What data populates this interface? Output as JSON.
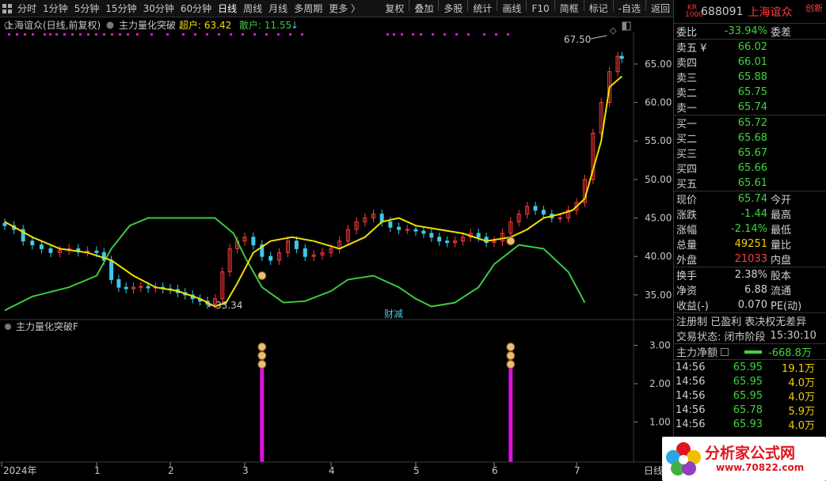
{
  "toolbar": {
    "left_items": [
      "分时",
      "1分钟",
      "5分钟",
      "15分钟",
      "30分钟",
      "60分钟",
      "日线",
      "周线",
      "月线",
      "多周期",
      "更多 〉"
    ],
    "active_item": "日线",
    "right_items": [
      "复权",
      "叠加",
      "多股",
      "统计",
      "画线",
      "F10",
      "简框",
      "标记",
      "-自选",
      "返回"
    ]
  },
  "main_chart": {
    "stock_label": "上海谊众(日线,前复权)",
    "indicator_name": "主力量化突破",
    "chao_label": "超户: 63.42",
    "san_label": "散户: 11.55",
    "high_label": "67.50",
    "low_label": "33.34",
    "annotation": "财减",
    "y_ticks": [
      "65.00",
      "60.00",
      "55.00",
      "50.00",
      "45.00",
      "40.00",
      "35.00"
    ]
  },
  "sub_chart": {
    "indicator_name": "主力量化突破F",
    "y_ticks": [
      "3.00",
      "2.00",
      "1.00"
    ],
    "signal_months": [
      "3",
      "6"
    ]
  },
  "x_axis": {
    "labels": [
      "2024年",
      "1",
      "2",
      "3",
      "4",
      "5",
      "6",
      "7"
    ],
    "period_label": "日线"
  },
  "chart_data": {
    "type": "line",
    "series": [
      {
        "name": "超户",
        "color": "#3ec83e",
        "x_month": [
          0.0,
          0.3,
          0.7,
          1.0,
          1.2,
          1.45,
          1.7,
          2.0,
          2.3,
          2.6,
          2.85,
          3.0,
          3.2,
          3.45,
          3.7,
          4.0,
          4.2,
          4.5,
          4.8,
          5.0,
          5.2,
          5.5,
          5.8,
          6.0,
          6.3,
          6.6,
          6.9,
          7.1
        ],
        "values": [
          33.0,
          34.8,
          36.0,
          37.5,
          41.0,
          44.0,
          45.0,
          45.0,
          45.0,
          45.0,
          43.0,
          40.0,
          36.0,
          34.0,
          34.2,
          35.5,
          37.0,
          37.5,
          36.0,
          34.5,
          33.5,
          34.0,
          36.0,
          39.0,
          41.5,
          41.0,
          38.0,
          34.0
        ]
      },
      {
        "name": "散户",
        "color": "#f0e000",
        "x_month": [
          0.0,
          0.3,
          0.6,
          0.9,
          1.2,
          1.5,
          1.8,
          2.1,
          2.4,
          2.6,
          2.75,
          2.9,
          3.1,
          3.3,
          3.55,
          3.8,
          4.1,
          4.4,
          4.6,
          4.8,
          5.0,
          5.3,
          5.6,
          5.9,
          6.2,
          6.4,
          6.6,
          6.8,
          6.95,
          7.1,
          7.3,
          7.4,
          7.55
        ],
        "values": [
          44.5,
          42.5,
          41.0,
          40.5,
          39.5,
          37.5,
          36.0,
          35.5,
          34.5,
          33.5,
          34.0,
          36.5,
          40.5,
          42.0,
          42.5,
          42.0,
          41.0,
          42.5,
          44.5,
          45.0,
          44.0,
          43.5,
          43.0,
          42.0,
          42.5,
          43.5,
          45.0,
          45.5,
          46.0,
          47.5,
          55.0,
          62.0,
          63.4
        ]
      }
    ],
    "candles_x_month": [
      0.0,
      0.1,
      0.2,
      0.3,
      0.4,
      0.5,
      0.6,
      0.7,
      0.8,
      0.9,
      1.0,
      1.1,
      1.2,
      1.3,
      1.4,
      1.5,
      1.6,
      1.7,
      1.8,
      1.9,
      2.0,
      2.1,
      2.2,
      2.3,
      2.4,
      2.5,
      2.6,
      2.7,
      2.8,
      2.9,
      3.0,
      3.1,
      3.2,
      3.3,
      3.4,
      3.5,
      3.6,
      3.7,
      3.8,
      3.9,
      4.0,
      4.1,
      4.2,
      4.3,
      4.4,
      4.5,
      4.6,
      4.7,
      4.8,
      4.9,
      5.0,
      5.1,
      5.2,
      5.3,
      5.4,
      5.5,
      5.6,
      5.7,
      5.8,
      5.9,
      6.0,
      6.1,
      6.2,
      6.3,
      6.4,
      6.5,
      6.6,
      6.7,
      6.8,
      6.9,
      7.0,
      7.1,
      7.2,
      7.3,
      7.4,
      7.5,
      7.55
    ],
    "candles_close": [
      44.0,
      43.5,
      42.0,
      41.5,
      41.0,
      40.5,
      40.8,
      41.0,
      40.6,
      40.7,
      40.5,
      39.5,
      37.0,
      36.0,
      35.8,
      36.0,
      36.1,
      35.9,
      36.0,
      35.8,
      35.7,
      35.3,
      35.0,
      34.5,
      34.2,
      33.8,
      34.5,
      38.0,
      41.0,
      42.0,
      42.5,
      41.5,
      40.0,
      39.5,
      40.5,
      42.0,
      41.0,
      40.0,
      40.2,
      40.5,
      41.0,
      42.0,
      43.5,
      44.5,
      45.0,
      45.5,
      44.5,
      43.8,
      43.5,
      43.5,
      43.3,
      43.0,
      42.5,
      42.0,
      41.8,
      42.0,
      42.5,
      43.0,
      42.5,
      41.8,
      42.0,
      43.0,
      44.5,
      45.5,
      46.5,
      46.0,
      45.5,
      45.0,
      45.0,
      46.0,
      47.0,
      50.0,
      56.0,
      60.0,
      64.0,
      66.0,
      65.74
    ],
    "x_range_month": [
      0,
      7.8
    ],
    "y_range": [
      32,
      69
    ],
    "signal_x_month": [
      3.2,
      6.2
    ],
    "signal_value": 3.0,
    "sub_y_range": [
      0,
      3.3
    ],
    "colors": {
      "up": "#ff3b3b",
      "down": "#3fc9e8",
      "grid": "#2a2a2a",
      "signal": "#e010e0"
    }
  },
  "panel": {
    "kr_top": "KR",
    "kr_bottom": "1000",
    "code": "688091",
    "name": "上海谊众",
    "badge": "创新",
    "weibi": {
      "label": "委比",
      "value": "-33.94%",
      "extra": "委差"
    },
    "sells": [
      {
        "label": "卖五 ¥",
        "price": "66.02"
      },
      {
        "label": "卖四",
        "price": "66.01"
      },
      {
        "label": "卖三",
        "price": "65.88"
      },
      {
        "label": "卖二",
        "price": "65.75"
      },
      {
        "label": "卖一",
        "price": "65.74"
      }
    ],
    "buys": [
      {
        "label": "买一",
        "price": "65.72"
      },
      {
        "label": "买二",
        "price": "65.68"
      },
      {
        "label": "买三",
        "price": "65.67"
      },
      {
        "label": "买四",
        "price": "65.66"
      },
      {
        "label": "买五",
        "price": "65.61"
      }
    ],
    "quote": [
      {
        "k": "现价",
        "v": "65.74",
        "cls": "green",
        "k2": "今开"
      },
      {
        "k": "涨跌",
        "v": "-1.44",
        "cls": "green",
        "k2": "最高"
      },
      {
        "k": "涨幅",
        "v": "-2.14%",
        "cls": "green",
        "k2": "最低"
      },
      {
        "k": "总量",
        "v": "49251",
        "cls": "yellow",
        "k2": "量比"
      },
      {
        "k": "外盘",
        "v": "21033",
        "cls": "red",
        "k2": "内盘"
      }
    ],
    "stats": [
      {
        "k": "换手",
        "v": "2.38%",
        "k2": "股本"
      },
      {
        "k": "净资",
        "v": "6.88",
        "k2": "流通"
      },
      {
        "k": "收益(-)",
        "v": "0.070",
        "k2": "PE(动)"
      }
    ],
    "status_line1": "注册制 已盈利 表决权无差异",
    "status_line2_label": "交易状态: 闭市阶段",
    "status_line2_time": "15:30:10",
    "zhuli_label": "主力净额",
    "zhuli_value": "-668.8万",
    "ticks": [
      {
        "t": "14:56",
        "p": "65.95",
        "v": "19.1万"
      },
      {
        "t": "14:56",
        "p": "65.95",
        "v": "4.0万"
      },
      {
        "t": "14:56",
        "p": "65.95",
        "v": "4.0万"
      },
      {
        "t": "14:56",
        "p": "65.78",
        "v": "5.9万"
      },
      {
        "t": "14:56",
        "p": "65.93",
        "v": "4.0万"
      }
    ]
  },
  "watermark": {
    "brand": "分析家公式网",
    "url": "www.70822.com"
  }
}
